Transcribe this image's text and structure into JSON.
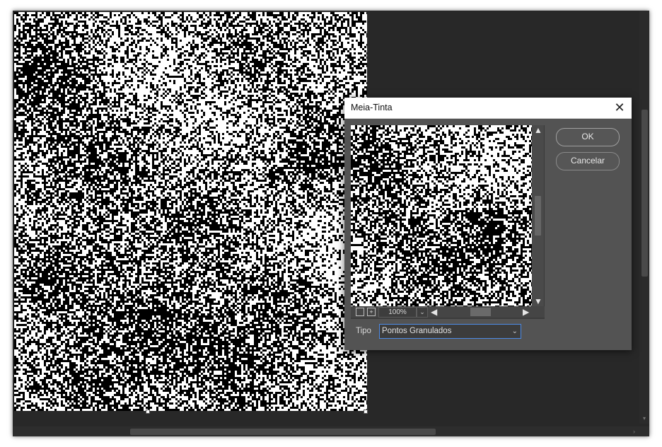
{
  "canvas": {
    "description": "noise-halftone-image"
  },
  "dialog": {
    "title": "Meia-Tinta",
    "close_glyph": "✕",
    "ok_label": "OK",
    "cancel_label": "Cancelar",
    "preview": {
      "zoom_value": "100%"
    },
    "type_field": {
      "label": "Tipo",
      "selected": "Pontos Granulados"
    }
  }
}
